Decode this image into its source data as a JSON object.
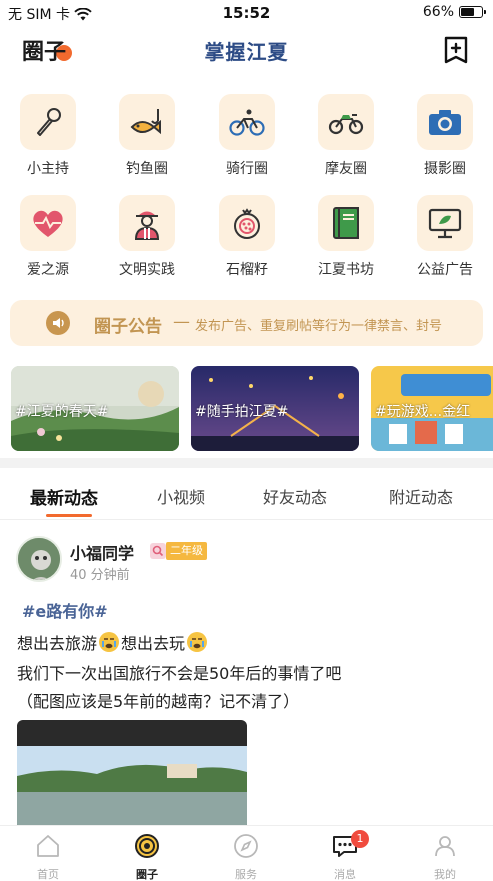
{
  "status_bar": {
    "carrier": "无 SIM 卡",
    "time": "15:52",
    "battery": "66%",
    "battery_level": 0.66
  },
  "header": {
    "left_title": "圈子",
    "title": "掌握江夏"
  },
  "categories": [
    {
      "label": "小主持",
      "icon": "microphone-icon"
    },
    {
      "label": "钓鱼圈",
      "icon": "fish-icon"
    },
    {
      "label": "骑行圈",
      "icon": "bicycle-icon"
    },
    {
      "label": "摩友圈",
      "icon": "motorcycle-icon"
    },
    {
      "label": "摄影圈",
      "icon": "camera-icon"
    },
    {
      "label": "爱之源",
      "icon": "heart-pulse-icon"
    },
    {
      "label": "文明实践",
      "icon": "volunteer-icon"
    },
    {
      "label": "石榴籽",
      "icon": "pomegranate-icon"
    },
    {
      "label": "江夏书坊",
      "icon": "book-icon"
    },
    {
      "label": "公益广告",
      "icon": "billboard-icon"
    }
  ],
  "notice": {
    "title": "圈子公告",
    "dash": "—",
    "text": "发布广告、重复刷帖等行为一律禁言、封号"
  },
  "banners": [
    {
      "label": "#江夏的春天#"
    },
    {
      "label": "#随手拍江夏#"
    },
    {
      "label": "#玩游戏...金红"
    }
  ],
  "tabs": [
    "最新动态",
    "小视频",
    "好友动态",
    "附近动态"
  ],
  "post": {
    "user": "小福同学",
    "grade": "二年级",
    "time": "40 分钟前",
    "topic": "#e路有你#",
    "line1_a": "想出去旅游",
    "line1_b": "想出去玩",
    "line2": "我们下一次出国旅行不会是50年后的事情了吧",
    "line3": "（配图应该是5年前的越南？记不清了）"
  },
  "bottom_nav": [
    {
      "label": "首页",
      "icon": "home-icon"
    },
    {
      "label": "圈子",
      "icon": "circle-icon"
    },
    {
      "label": "服务",
      "icon": "compass-icon"
    },
    {
      "label": "消息",
      "icon": "message-icon",
      "badge": "1"
    },
    {
      "label": "我的",
      "icon": "profile-icon"
    }
  ],
  "colors": {
    "accent": "#f26a2e",
    "title_blue": "#2d4c86",
    "tile_bg": "#fdf0de",
    "notice_gold": "#c29552"
  }
}
